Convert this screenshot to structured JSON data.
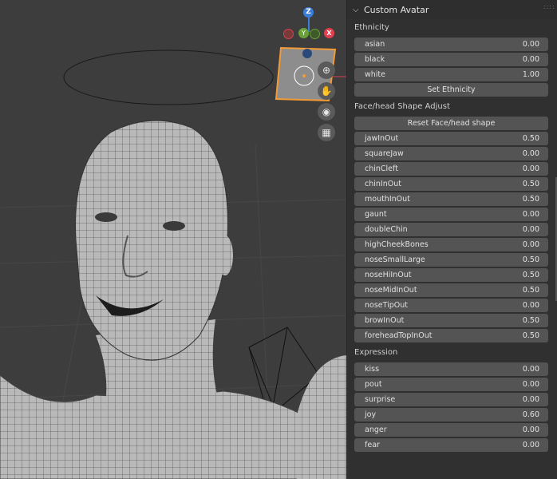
{
  "panel": {
    "title": "Custom Avatar",
    "ethnicity_label": "Ethnicity",
    "ethnicity": [
      {
        "label": "asian",
        "value": "0.00"
      },
      {
        "label": "black",
        "value": "0.00"
      },
      {
        "label": "white",
        "value": "1.00"
      }
    ],
    "set_ethnicity_button": "Set Ethnicity",
    "face_label": "Face/head Shape Adjust",
    "reset_face_button": "Reset Face/head shape",
    "face": [
      {
        "label": "jawInOut",
        "value": "0.50"
      },
      {
        "label": "squareJaw",
        "value": "0.00"
      },
      {
        "label": "chinCleft",
        "value": "0.00"
      },
      {
        "label": "chinInOut",
        "value": "0.50"
      },
      {
        "label": "mouthInOut",
        "value": "0.50"
      },
      {
        "label": "gaunt",
        "value": "0.00"
      },
      {
        "label": "doubleChin",
        "value": "0.00"
      },
      {
        "label": "highCheekBones",
        "value": "0.00"
      },
      {
        "label": "noseSmallLarge",
        "value": "0.50"
      },
      {
        "label": "noseHiInOut",
        "value": "0.50"
      },
      {
        "label": "noseMidInOut",
        "value": "0.50"
      },
      {
        "label": "noseTipOut",
        "value": "0.00"
      },
      {
        "label": "browInOut",
        "value": "0.50"
      },
      {
        "label": "foreheadTopInOut",
        "value": "0.50"
      }
    ],
    "expression_label": "Expression",
    "expression": [
      {
        "label": "kiss",
        "value": "0.00"
      },
      {
        "label": "pout",
        "value": "0.00"
      },
      {
        "label": "surprise",
        "value": "0.00"
      },
      {
        "label": "joy",
        "value": "0.60"
      },
      {
        "label": "anger",
        "value": "0.00"
      },
      {
        "label": "fear",
        "value": "0.00"
      }
    ]
  },
  "gizmo": {
    "z": "Z",
    "y": "Y",
    "x": "X"
  },
  "icons": {
    "zoom": "zoom-icon",
    "pan": "hand-icon",
    "camera": "camera-icon",
    "grid": "grid-icon"
  },
  "colors": {
    "x_axis": "#e0404f",
    "y_axis": "#6ba237",
    "z_axis": "#3a7ed9",
    "panel_bg": "#303030",
    "field_bg": "#545454"
  }
}
